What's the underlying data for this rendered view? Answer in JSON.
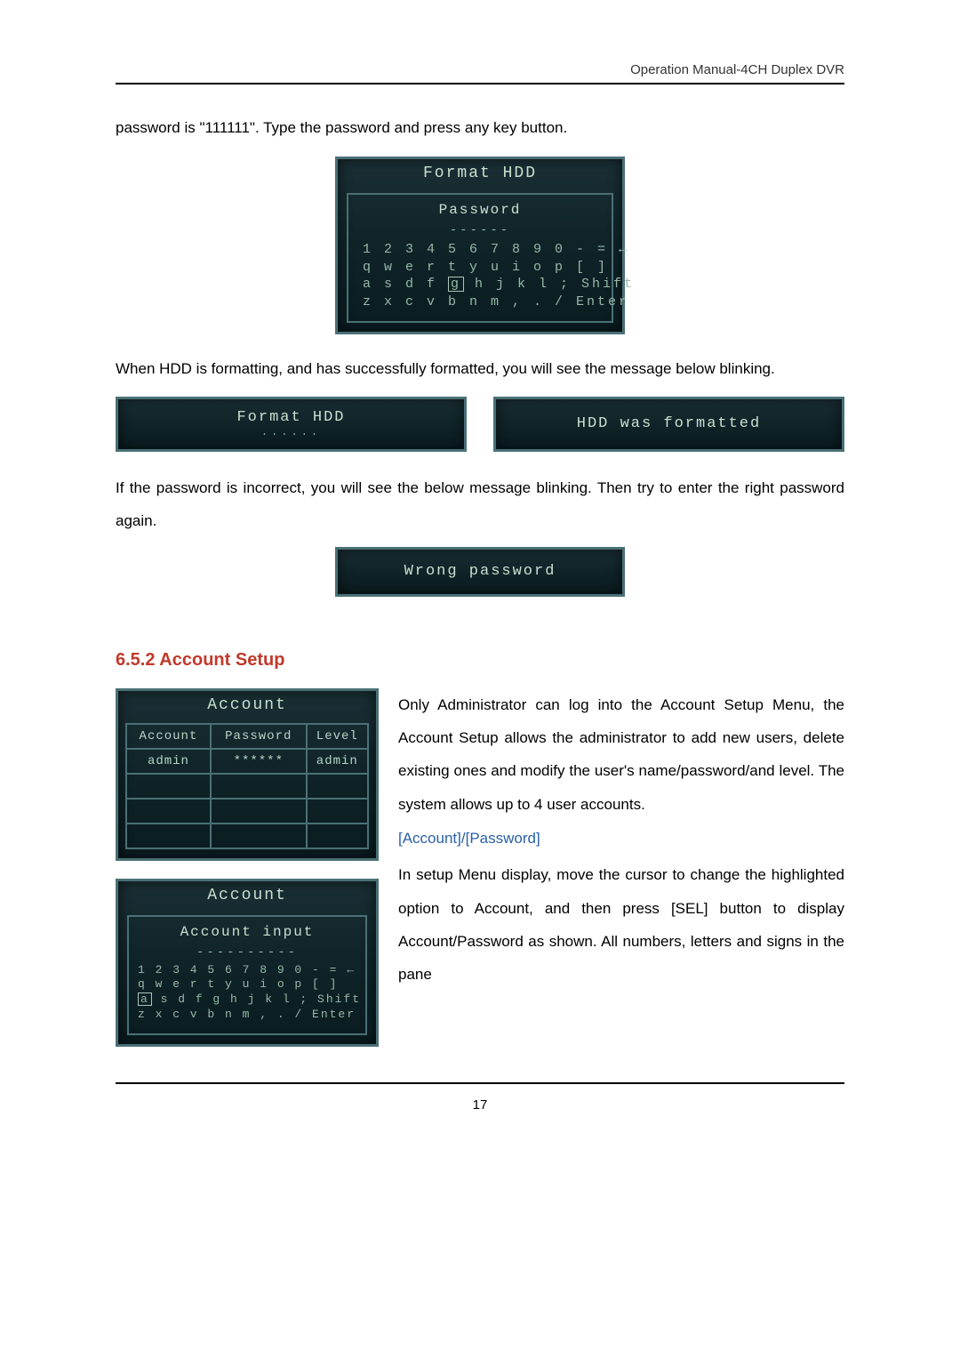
{
  "header": {
    "doc_title": "Operation Manual-4CH Duplex DVR"
  },
  "text": {
    "p1": "password is \"111111\". Type the password and press any key button.",
    "p2": "When HDD is formatting, and has successfully formatted, you will see the message below blinking.",
    "p3": "If the password is incorrect, you will see the below message blinking. Then try to enter the right password again.",
    "acct_p1": "Only Administrator can log into the Account Setup Menu, the Account Setup allows the administrator to add new users, delete existing ones and modify the user's name/password/and level. The system allows up to 4 user accounts.",
    "acct_sub": "[Account]/[Password]",
    "acct_p2": "In setup Menu display, move the cursor to change the highlighted option to Account, and then press [SEL] button to display Account/Password as shown. All numbers, letters and signs in the pane"
  },
  "section": {
    "heading": "6.5.2 Account Setup"
  },
  "panel_format": {
    "title": "Format HDD",
    "sub": "Password",
    "dashes": "------",
    "kb": {
      "r1": "1 2 3 4 5 6 7 8 9 0 - = ←",
      "r2a": "q w e r t y u i o p [ ]",
      "r3a": "a s d f ",
      "r3cur": "g",
      "r3b": " h j k l ; Shift",
      "r4": "z x c v b n m , . / Enter"
    }
  },
  "panel_formatting": {
    "title": "Format HDD",
    "dots": "......"
  },
  "panel_formatted": {
    "title": "HDD was formatted"
  },
  "panel_wrong": {
    "title": "Wrong password"
  },
  "panel_acct_list": {
    "title": "Account",
    "headers": {
      "c1": "Account",
      "c2": "Password",
      "c3": "Level"
    },
    "row1": {
      "c1": "admin",
      "c2": "******",
      "c3": "admin"
    }
  },
  "panel_acct_input": {
    "title": "Account",
    "sub": "Account input",
    "dashes": "----------",
    "kb": {
      "r1": "1 2 3 4 5 6 7 8 9 0 - = ←",
      "r2": "q w e r t y u i o p [ ]",
      "r3cur": "a",
      "r3b": " s d f g h j k l ; Shift",
      "r4": "z x c v b n m , . / Enter"
    }
  },
  "footer": {
    "page": "17"
  }
}
